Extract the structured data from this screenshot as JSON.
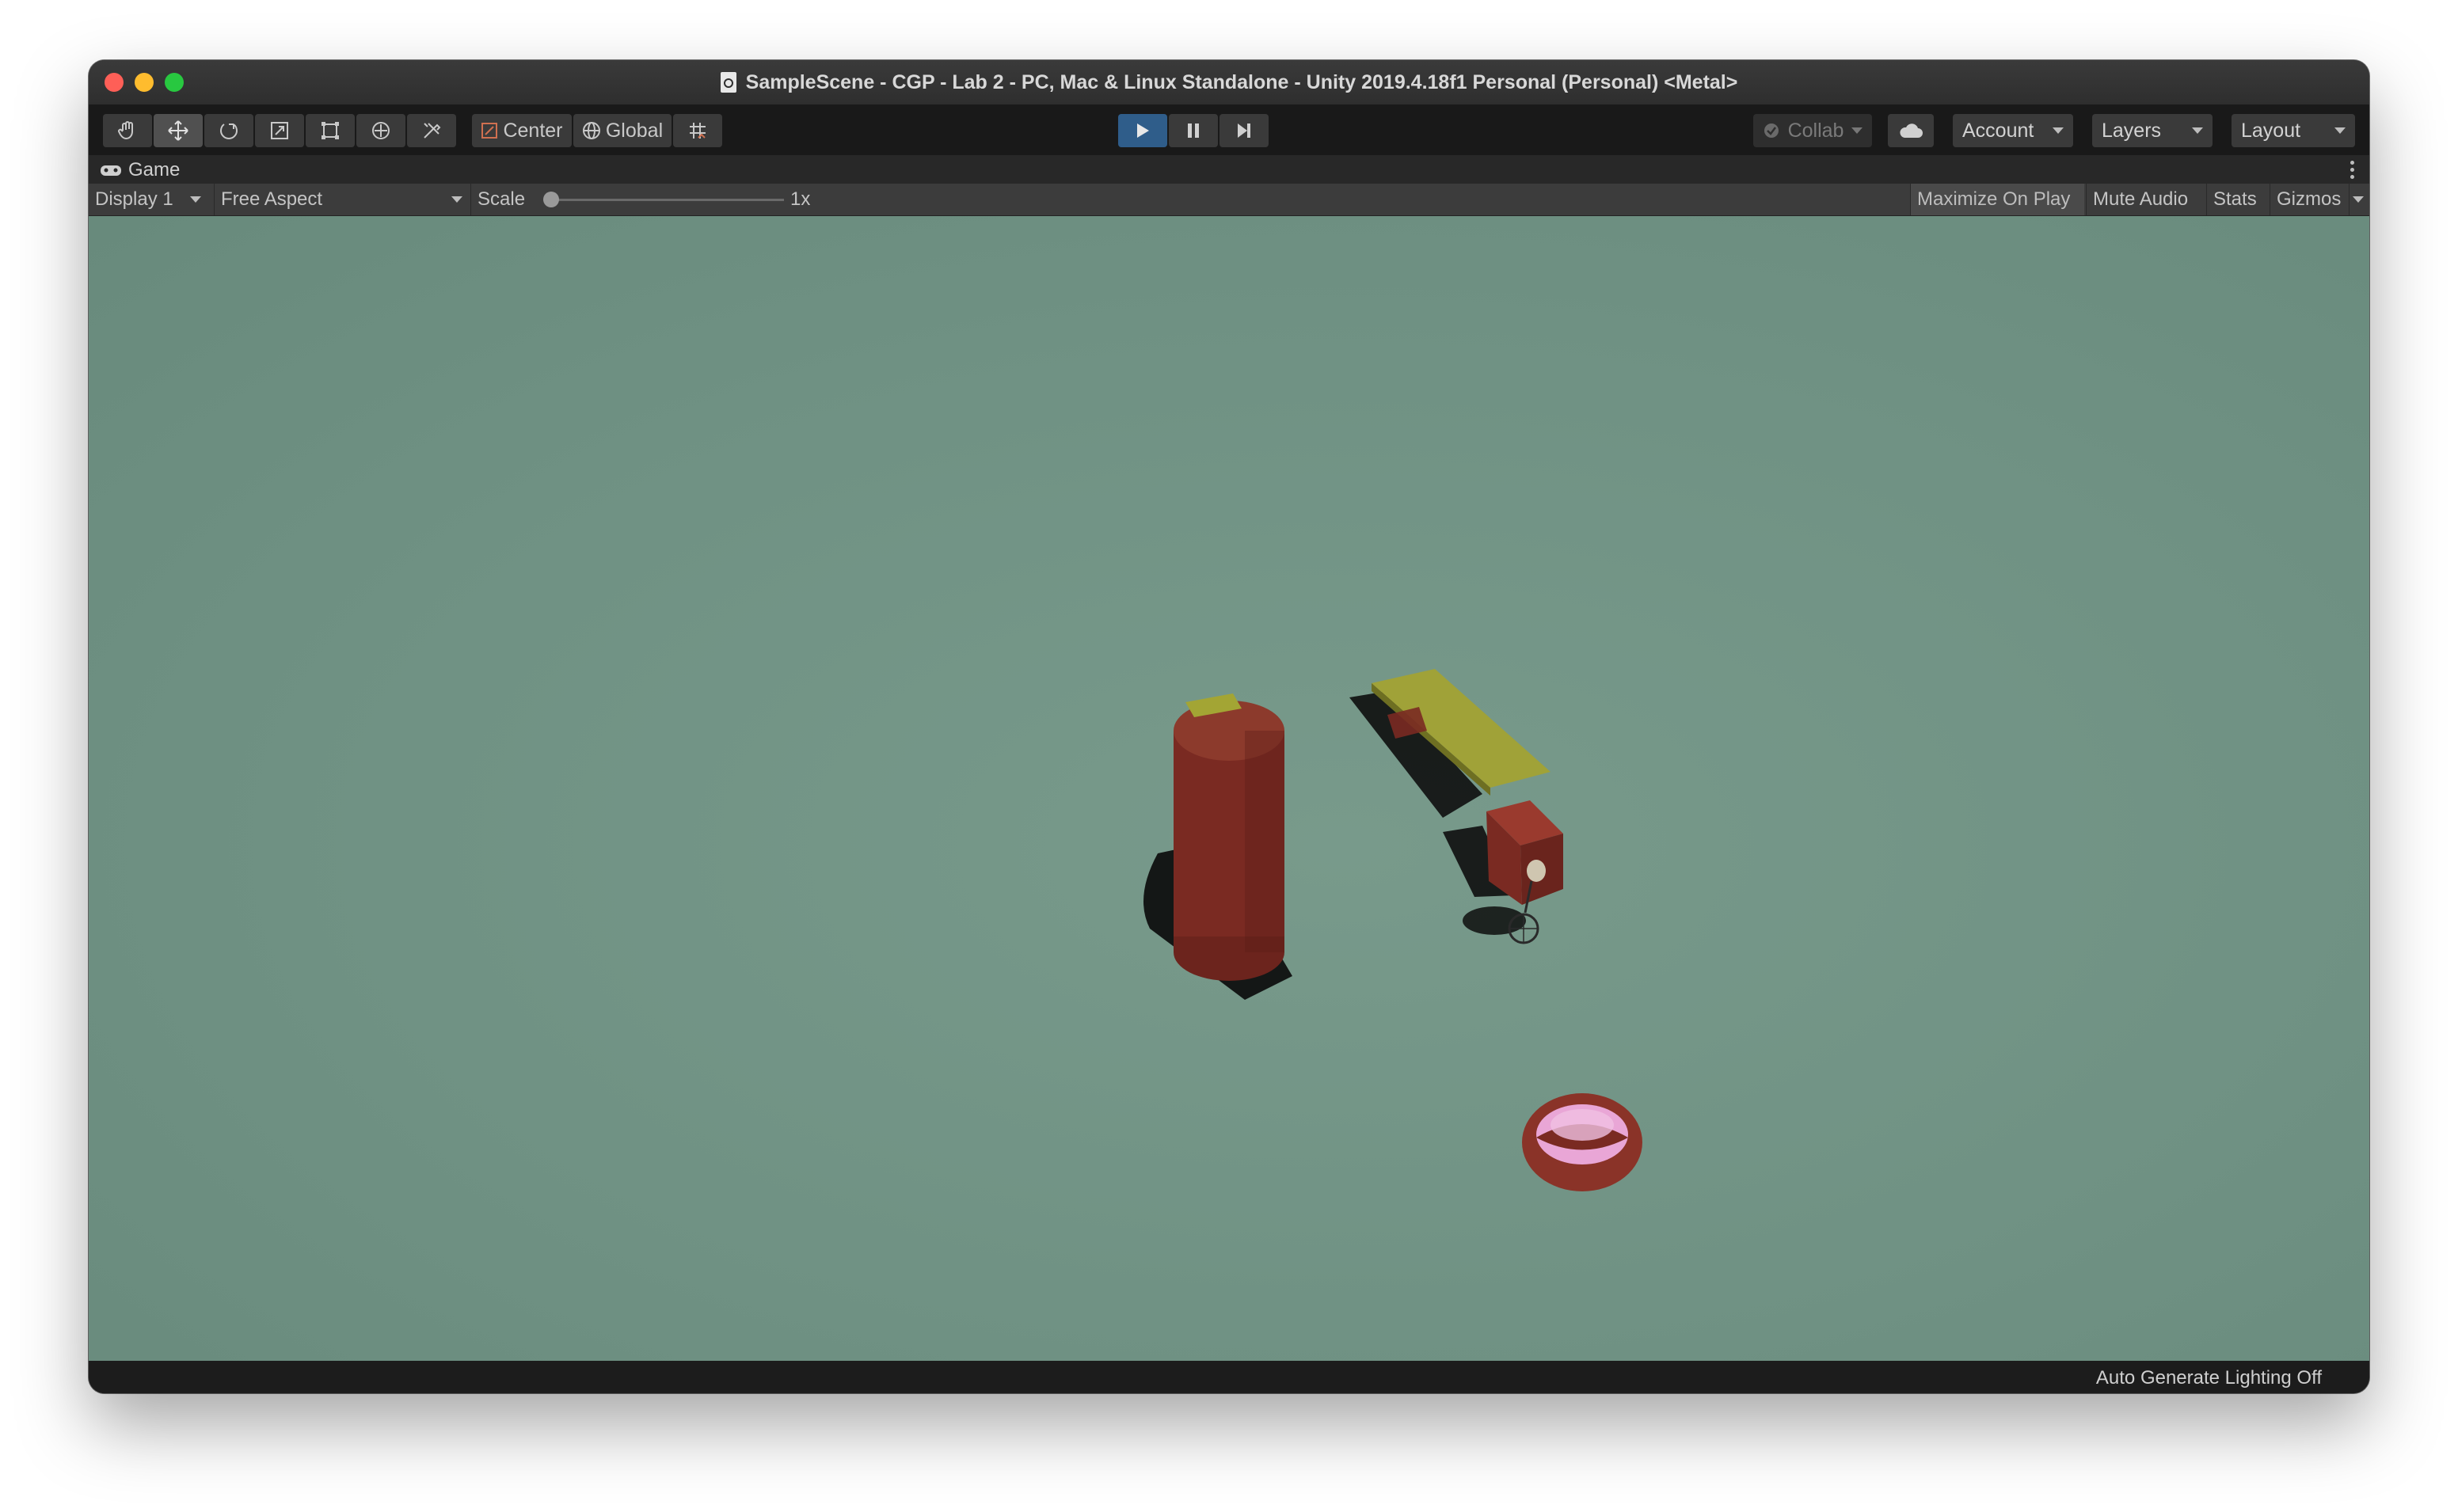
{
  "window": {
    "title": "SampleScene - CGP - Lab 2 - PC, Mac & Linux Standalone - Unity 2019.4.18f1 Personal (Personal) <Metal>"
  },
  "toolbar": {
    "tools": [
      "hand-tool",
      "move-tool",
      "rotate-tool",
      "scale-tool",
      "rect-tool",
      "transform-tool",
      "custom-tool"
    ],
    "pivot_mode_label": "Center",
    "pivot_rotation_label": "Global",
    "collab_label": "Collab",
    "account_label": "Account",
    "layers_label": "Layers",
    "layout_label": "Layout"
  },
  "game_tab": {
    "label": "Game"
  },
  "game_toolbar": {
    "display_label": "Display 1",
    "aspect_label": "Free Aspect",
    "scale_label": "Scale",
    "scale_value": "1x",
    "maximize_label": "Maximize On Play",
    "mute_label": "Mute Audio",
    "stats_label": "Stats",
    "gizmos_label": "Gizmos"
  },
  "status_bar": {
    "lighting_text": "Auto Generate Lighting Off"
  },
  "colors": {
    "ground": "#6f9183",
    "object_red": "#8a3328",
    "object_yellow": "#9ea232",
    "play_active": "#2f5d8a",
    "bowl_pink": "#e9a6d6"
  }
}
